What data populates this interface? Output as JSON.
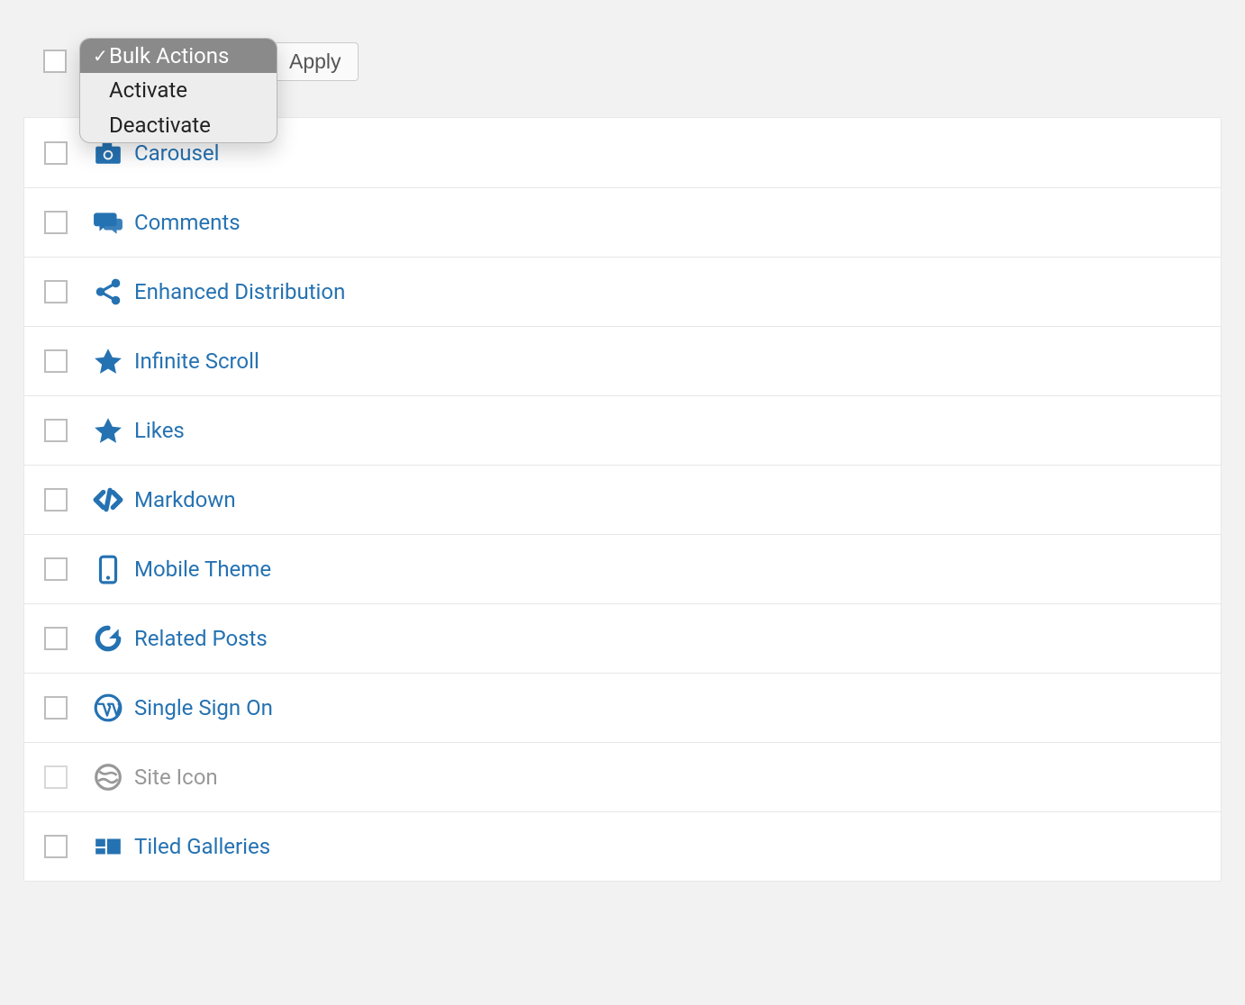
{
  "toolbar": {
    "apply_label": "Apply"
  },
  "dropdown": {
    "items": [
      {
        "label": "Bulk Actions",
        "selected": true
      },
      {
        "label": "Activate",
        "selected": false
      },
      {
        "label": "Deactivate",
        "selected": false
      }
    ]
  },
  "modules": [
    {
      "label": "Carousel",
      "icon": "camera",
      "disabled": false
    },
    {
      "label": "Comments",
      "icon": "comments",
      "disabled": false
    },
    {
      "label": "Enhanced Distribution",
      "icon": "share",
      "disabled": false
    },
    {
      "label": "Infinite Scroll",
      "icon": "star",
      "disabled": false
    },
    {
      "label": "Likes",
      "icon": "star",
      "disabled": false
    },
    {
      "label": "Markdown",
      "icon": "code",
      "disabled": false
    },
    {
      "label": "Mobile Theme",
      "icon": "mobile",
      "disabled": false
    },
    {
      "label": "Related Posts",
      "icon": "refresh",
      "disabled": false
    },
    {
      "label": "Single Sign On",
      "icon": "wordpress",
      "disabled": false
    },
    {
      "label": "Site Icon",
      "icon": "globe",
      "disabled": true
    },
    {
      "label": "Tiled Galleries",
      "icon": "tiles",
      "disabled": false
    }
  ]
}
